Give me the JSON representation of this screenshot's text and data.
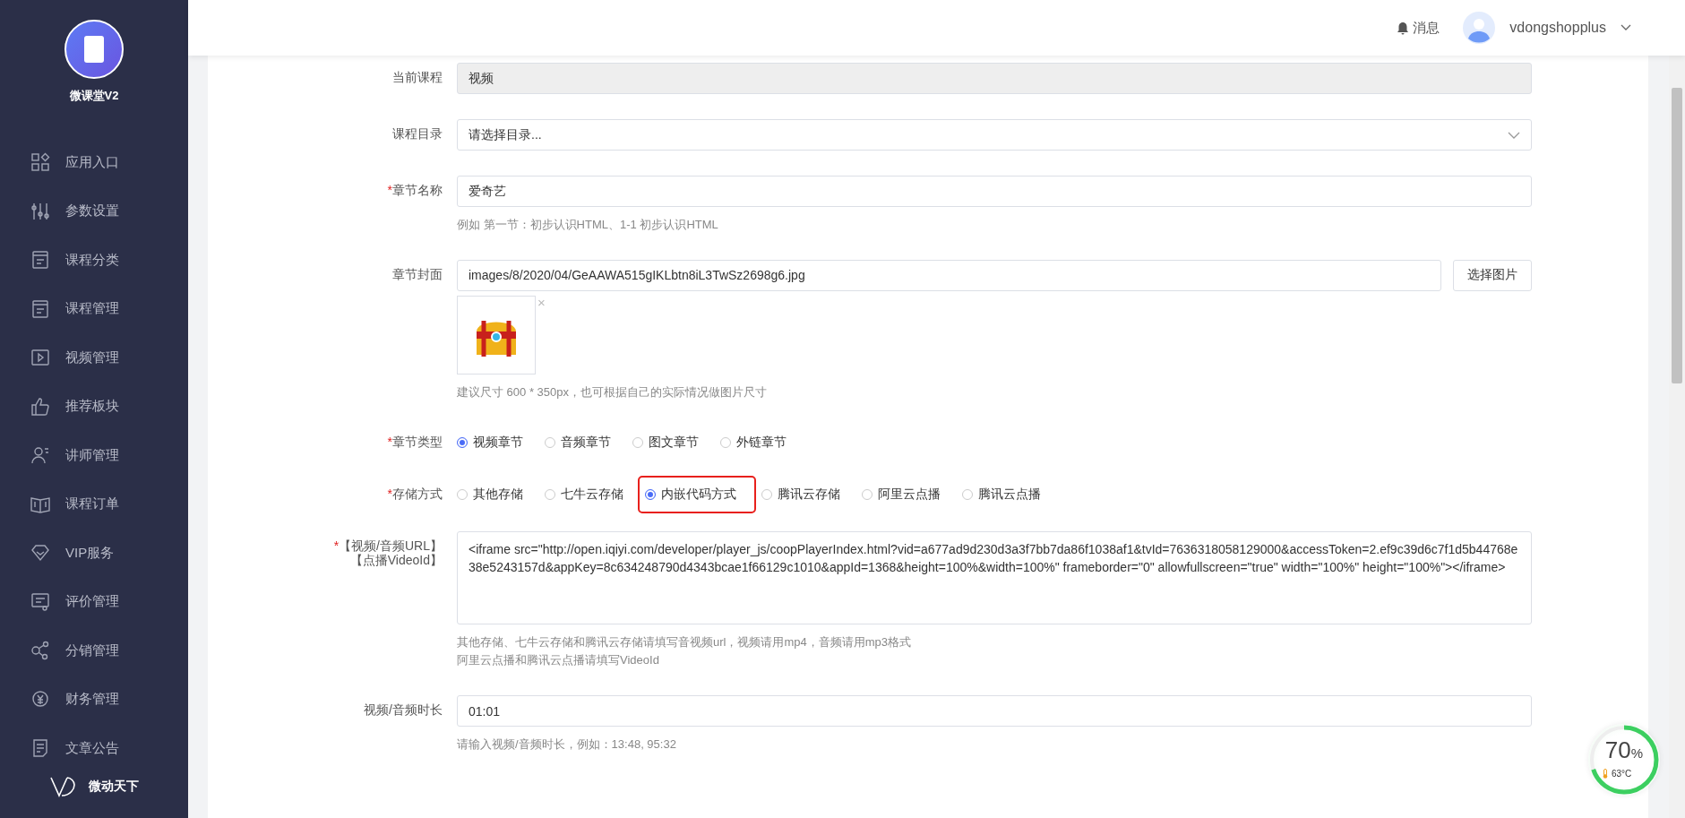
{
  "sidebar": {
    "app_name": "微课堂V2",
    "items": [
      {
        "label": "应用入口",
        "selected": false
      },
      {
        "label": "参数设置",
        "selected": false
      },
      {
        "label": "课程分类",
        "selected": false
      },
      {
        "label": "课程管理",
        "selected": false
      },
      {
        "label": "视频管理",
        "selected": false
      },
      {
        "label": "推荐板块",
        "selected": false
      },
      {
        "label": "讲师管理",
        "selected": false
      },
      {
        "label": "课程订单",
        "selected": false
      },
      {
        "label": "VIP服务",
        "selected": false
      },
      {
        "label": "评价管理",
        "selected": false
      },
      {
        "label": "分销管理",
        "selected": false
      },
      {
        "label": "财务管理",
        "selected": false
      },
      {
        "label": "文章公告",
        "selected": false
      }
    ],
    "brand": "微动天下"
  },
  "header": {
    "messages": "消息",
    "username": "vdongshopplus"
  },
  "form": {
    "rows": [
      {
        "kind": "input",
        "label": [
          "当前课程"
        ],
        "value": "视频",
        "disabled": true
      },
      {
        "kind": "select",
        "label": [
          "课程目录"
        ],
        "value": "请选择目录..."
      },
      {
        "kind": "input",
        "label": [
          "章节名称"
        ],
        "required_mark": "*",
        "value": "爱奇艺",
        "disabled": false,
        "hints": [
          "例如 第一节：初步认识HTML、1-1 初步认识HTML"
        ]
      },
      {
        "kind": "image",
        "label": [
          "章节封面"
        ],
        "value": "images/8/2020/04/GeAAWA515gIKLbtn8iL3TwSz2698g6.jpg",
        "button": "选择图片",
        "remove": "×",
        "hints": [
          "建议尺寸 600 * 350px，也可根据自己的实际情况做图片尺寸"
        ]
      },
      {
        "kind": "radio",
        "label": [
          "章节类型"
        ],
        "required_mark": "*",
        "options": [
          {
            "label": "视频章节",
            "selected": true,
            "highlighted": false
          },
          {
            "label": "音频章节",
            "selected": false,
            "highlighted": false
          },
          {
            "label": "图文章节",
            "selected": false,
            "highlighted": false
          },
          {
            "label": "外链章节",
            "selected": false,
            "highlighted": false
          }
        ]
      },
      {
        "kind": "radio",
        "label": [
          "存储方式"
        ],
        "required_mark": "*",
        "options": [
          {
            "label": "其他存储",
            "selected": false,
            "highlighted": false
          },
          {
            "label": "七牛云存储",
            "selected": false,
            "highlighted": false
          },
          {
            "label": "内嵌代码方式",
            "selected": true,
            "highlighted": true
          },
          {
            "label": "腾讯云存储",
            "selected": false,
            "highlighted": false
          },
          {
            "label": "阿里云点播",
            "selected": false,
            "highlighted": false
          },
          {
            "label": "腾讯云点播",
            "selected": false,
            "highlighted": false
          }
        ]
      },
      {
        "kind": "textarea",
        "label": [
          "【视频/音频URL】",
          "【点播VideoId】"
        ],
        "required_mark": "*",
        "value": "<iframe src=\"http://open.iqiyi.com/developer/player_js/coopPlayerIndex.html?vid=a677ad9d230d3a3f7bb7da86f1038af1&tvId=7636318058129000&accessToken=2.ef9c39d6c7f1d5b44768e38e5243157d&appKey=8c634248790d4343bcae1f66129c1010&appId=1368&height=100%&width=100%\" frameborder=\"0\" allowfullscreen=\"true\" width=\"100%\" height=\"100%\"></iframe>",
        "hints": [
          "其他存储、七牛云存储和腾讯云存储请填写音视频url，视频请用mp4，音频请用mp3格式",
          "阿里云点播和腾讯云点播请填写VideoId"
        ]
      },
      {
        "kind": "input",
        "label": [
          "视频/音频时长"
        ],
        "value": "01:01",
        "disabled": false,
        "hints": [
          "请输入视频/音频时长，例如：13:48, 95:32"
        ]
      }
    ]
  },
  "gauge": {
    "value": "70",
    "unit": "%",
    "temperature": "63°C",
    "level": 0.7
  }
}
